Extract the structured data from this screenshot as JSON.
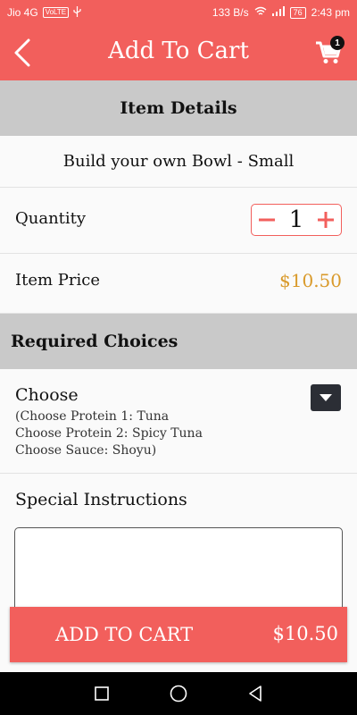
{
  "status_bar": {
    "carrier": "Jio 4G",
    "volte": "VoLTE",
    "speed": "133 B/s",
    "battery": "76",
    "time": "2:43 pm"
  },
  "header": {
    "title": "Add To Cart",
    "cart_count": "1"
  },
  "item_details": {
    "section_title": "Item Details",
    "item_name": "Build your own Bowl - Small",
    "quantity_label": "Quantity",
    "quantity_value": "1",
    "price_label": "Item Price",
    "price_value": "$10.50"
  },
  "required_choices": {
    "section_title": "Required Choices",
    "choose_label": "Choose",
    "selections": [
      "(Choose Protein 1: Tuna",
      "Choose Protein 2: Spicy Tuna",
      "Choose Sauce: Shoyu)"
    ]
  },
  "special_instructions": {
    "label": "Special Instructions",
    "value": "",
    "placeholder": ""
  },
  "add_to_cart": {
    "label": "ADD TO CART",
    "total": "$10.50"
  },
  "colors": {
    "primary": "#f25f5c",
    "price": "#d99a2b",
    "section_bg": "#c9c9c9",
    "dropdown_bg": "#2b2e35"
  },
  "icons": [
    "back-arrow-icon",
    "cart-icon",
    "minus-icon",
    "plus-icon",
    "dropdown-arrow-icon",
    "recents-icon",
    "home-icon",
    "back-nav-icon"
  ]
}
